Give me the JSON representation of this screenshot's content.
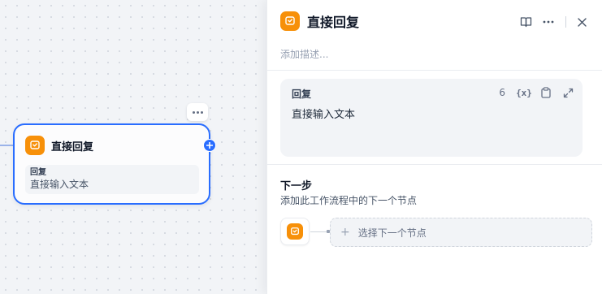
{
  "canvas": {
    "node": {
      "title": "直接回复",
      "body_label": "回复",
      "body_text": "直接输入文本",
      "icon": "reply-icon"
    }
  },
  "panel": {
    "title": "直接回复",
    "description_placeholder": "添加描述...",
    "actions": [
      "book-icon",
      "more-icon",
      "close-icon"
    ],
    "editor": {
      "label": "回复",
      "char_count": "6",
      "variable_button": "{x}",
      "content": "直接输入文本"
    },
    "next_step": {
      "title": "下一步",
      "description": "添加此工作流程中的下一个节点",
      "select_label": "选择下一个节点",
      "plus": "+"
    }
  },
  "colors": {
    "accent": "#296dff",
    "node_icon": "#f79009"
  }
}
